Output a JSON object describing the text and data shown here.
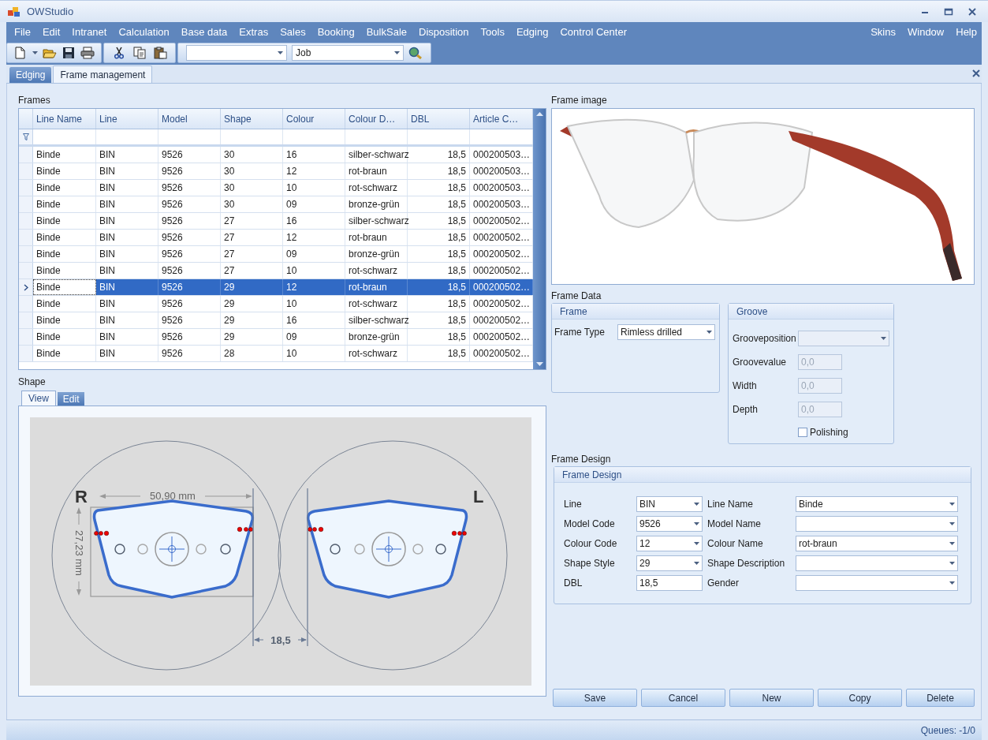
{
  "window": {
    "title": "OWStudio"
  },
  "menu": [
    {
      "label": "File"
    },
    {
      "label": "Edit"
    },
    {
      "label": "Intranet"
    },
    {
      "label": "Calculation"
    },
    {
      "label": "Base data"
    },
    {
      "label": "Extras"
    },
    {
      "label": "Sales"
    },
    {
      "label": "Booking"
    },
    {
      "label": "BulkSale"
    },
    {
      "label": "Disposition"
    },
    {
      "label": "Tools"
    },
    {
      "label": "Edging"
    },
    {
      "label": "Control Center"
    }
  ],
  "menu_right": [
    {
      "label": "Skins"
    },
    {
      "label": "Window"
    },
    {
      "label": "Help"
    }
  ],
  "toolbar": {
    "job_combo": {
      "value": "Job"
    }
  },
  "tabs": [
    {
      "label": "Edging",
      "selected": false
    },
    {
      "label": "Frame management",
      "selected": true
    }
  ],
  "frames": {
    "label": "Frames",
    "columns": [
      "Line Name",
      "Line",
      "Model",
      "Shape",
      "Colour",
      "Colour D…",
      "DBL",
      "Article C…"
    ],
    "rows": [
      {
        "cells": [
          "Binde",
          "BIN",
          "9526",
          "30",
          "16",
          "silber-schwarz",
          "18,5",
          "000200503…"
        ],
        "selected": false
      },
      {
        "cells": [
          "Binde",
          "BIN",
          "9526",
          "30",
          "12",
          "rot-braun",
          "18,5",
          "000200503…"
        ],
        "selected": false
      },
      {
        "cells": [
          "Binde",
          "BIN",
          "9526",
          "30",
          "10",
          "rot-schwarz",
          "18,5",
          "000200503…"
        ],
        "selected": false
      },
      {
        "cells": [
          "Binde",
          "BIN",
          "9526",
          "30",
          "09",
          "bronze-grün",
          "18,5",
          "000200503…"
        ],
        "selected": false
      },
      {
        "cells": [
          "Binde",
          "BIN",
          "9526",
          "27",
          "16",
          "silber-schwarz",
          "18,5",
          "000200502…"
        ],
        "selected": false
      },
      {
        "cells": [
          "Binde",
          "BIN",
          "9526",
          "27",
          "12",
          "rot-braun",
          "18,5",
          "000200502…"
        ],
        "selected": false
      },
      {
        "cells": [
          "Binde",
          "BIN",
          "9526",
          "27",
          "09",
          "bronze-grün",
          "18,5",
          "000200502…"
        ],
        "selected": false
      },
      {
        "cells": [
          "Binde",
          "BIN",
          "9526",
          "27",
          "10",
          "rot-schwarz",
          "18,5",
          "000200502…"
        ],
        "selected": false
      },
      {
        "cells": [
          "Binde",
          "BIN",
          "9526",
          "29",
          "12",
          "rot-braun",
          "18,5",
          "000200502…"
        ],
        "selected": true
      },
      {
        "cells": [
          "Binde",
          "BIN",
          "9526",
          "29",
          "10",
          "rot-schwarz",
          "18,5",
          "000200502…"
        ],
        "selected": false
      },
      {
        "cells": [
          "Binde",
          "BIN",
          "9526",
          "29",
          "16",
          "silber-schwarz",
          "18,5",
          "000200502…"
        ],
        "selected": false
      },
      {
        "cells": [
          "Binde",
          "BIN",
          "9526",
          "29",
          "09",
          "bronze-grün",
          "18,5",
          "000200502…"
        ],
        "selected": false
      },
      {
        "cells": [
          "Binde",
          "BIN",
          "9526",
          "28",
          "10",
          "rot-schwarz",
          "18,5",
          "000200502…"
        ],
        "selected": false
      }
    ]
  },
  "shape": {
    "label": "Shape",
    "tabs": [
      {
        "label": "View",
        "selected": true
      },
      {
        "label": "Edit",
        "selected": false
      }
    ],
    "drawing": {
      "right_label": "R",
      "left_label": "L",
      "width": "50,90 mm",
      "height": "27,23 mm",
      "dbl": "18,5"
    }
  },
  "frame_image": {
    "label": "Frame image"
  },
  "frame_data": {
    "label": "Frame Data",
    "frame": {
      "title": "Frame",
      "fields": [
        {
          "label": "Frame Type",
          "value": "Rimless drilled",
          "kind": "dropdown",
          "disabled": false
        }
      ]
    },
    "groove": {
      "title": "Groove",
      "fields": [
        {
          "label": "Grooveposition",
          "kind": "dropdown",
          "disabled": true
        },
        {
          "label": "Groovevalue",
          "value": "0,0",
          "kind": "text",
          "disabled": true
        },
        {
          "label": "Width",
          "value": "0,0",
          "kind": "text",
          "disabled": true
        },
        {
          "label": "Depth",
          "value": "0,0",
          "kind": "text",
          "disabled": true
        }
      ],
      "polishing": {
        "label": "Polishing",
        "checked": false
      }
    }
  },
  "frame_design": {
    "label": "Frame Design",
    "title": "Frame Design",
    "fields": [
      {
        "label": "Line",
        "value": "BIN",
        "kind": "dropdown"
      },
      {
        "label": "Line Name",
        "value": "Binde",
        "kind": "dropdown"
      },
      {
        "label": "Model Code",
        "value": "9526",
        "kind": "dropdown"
      },
      {
        "label": "Model Name",
        "kind": "dropdown"
      },
      {
        "label": "Colour Code",
        "value": "12",
        "kind": "dropdown"
      },
      {
        "label": "Colour Name",
        "value": "rot-braun",
        "kind": "dropdown"
      },
      {
        "label": "Shape Style",
        "value": "29",
        "kind": "dropdown"
      },
      {
        "label": "Shape Description",
        "kind": "dropdown"
      },
      {
        "label": "DBL",
        "value": "18,5",
        "kind": "text"
      },
      {
        "label": "Gender",
        "kind": "dropdown"
      }
    ]
  },
  "buttons": [
    "Save",
    "Cancel",
    "New",
    "Copy",
    "Delete"
  ],
  "status_bar": {
    "queues": "Queues: -1/0"
  }
}
